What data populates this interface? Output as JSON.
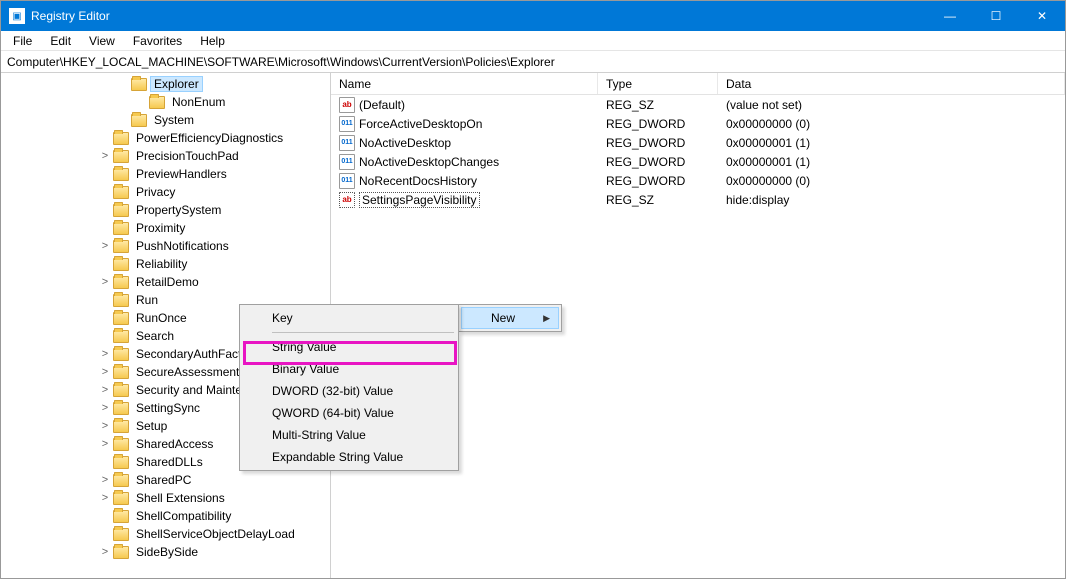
{
  "window": {
    "title": "Registry Editor"
  },
  "menu": {
    "items": [
      "File",
      "Edit",
      "View",
      "Favorites",
      "Help"
    ]
  },
  "address": {
    "path": "Computer\\HKEY_LOCAL_MACHINE\\SOFTWARE\\Microsoft\\Windows\\CurrentVersion\\Policies\\Explorer"
  },
  "tree": {
    "items": [
      {
        "depth": 0,
        "exp": "",
        "label": "Explorer",
        "selected": true
      },
      {
        "depth": 1,
        "exp": "",
        "label": "NonEnum"
      },
      {
        "depth": 0,
        "exp": "",
        "label": "System"
      },
      {
        "depth": -1,
        "exp": "",
        "label": "PowerEfficiencyDiagnostics"
      },
      {
        "depth": -1,
        "exp": ">",
        "label": "PrecisionTouchPad"
      },
      {
        "depth": -1,
        "exp": "",
        "label": "PreviewHandlers"
      },
      {
        "depth": -1,
        "exp": "",
        "label": "Privacy"
      },
      {
        "depth": -1,
        "exp": "",
        "label": "PropertySystem"
      },
      {
        "depth": -1,
        "exp": "",
        "label": "Proximity"
      },
      {
        "depth": -1,
        "exp": ">",
        "label": "PushNotifications"
      },
      {
        "depth": -1,
        "exp": "",
        "label": "Reliability"
      },
      {
        "depth": -1,
        "exp": ">",
        "label": "RetailDemo"
      },
      {
        "depth": -1,
        "exp": "",
        "label": "Run"
      },
      {
        "depth": -1,
        "exp": "",
        "label": "RunOnce"
      },
      {
        "depth": -1,
        "exp": "",
        "label": "Search"
      },
      {
        "depth": -1,
        "exp": ">",
        "label": "SecondaryAuthFactor"
      },
      {
        "depth": -1,
        "exp": ">",
        "label": "SecureAssessment"
      },
      {
        "depth": -1,
        "exp": ">",
        "label": "Security and Maintenance"
      },
      {
        "depth": -1,
        "exp": ">",
        "label": "SettingSync"
      },
      {
        "depth": -1,
        "exp": ">",
        "label": "Setup"
      },
      {
        "depth": -1,
        "exp": ">",
        "label": "SharedAccess"
      },
      {
        "depth": -1,
        "exp": "",
        "label": "SharedDLLs"
      },
      {
        "depth": -1,
        "exp": ">",
        "label": "SharedPC"
      },
      {
        "depth": -1,
        "exp": ">",
        "label": "Shell Extensions"
      },
      {
        "depth": -1,
        "exp": "",
        "label": "ShellCompatibility"
      },
      {
        "depth": -1,
        "exp": "",
        "label": "ShellServiceObjectDelayLoad"
      },
      {
        "depth": -1,
        "exp": ">",
        "label": "SideBySide"
      }
    ]
  },
  "list": {
    "headers": {
      "name": "Name",
      "type": "Type",
      "data": "Data"
    },
    "rows": [
      {
        "icon": "sz",
        "name": "(Default)",
        "type": "REG_SZ",
        "data": "(value not set)"
      },
      {
        "icon": "dw",
        "name": "ForceActiveDesktopOn",
        "type": "REG_DWORD",
        "data": "0x00000000 (0)"
      },
      {
        "icon": "dw",
        "name": "NoActiveDesktop",
        "type": "REG_DWORD",
        "data": "0x00000001 (1)"
      },
      {
        "icon": "dw",
        "name": "NoActiveDesktopChanges",
        "type": "REG_DWORD",
        "data": "0x00000001 (1)"
      },
      {
        "icon": "dw",
        "name": "NoRecentDocsHistory",
        "type": "REG_DWORD",
        "data": "0x00000000 (0)"
      },
      {
        "icon": "sz",
        "name": "SettingsPageVisibility",
        "type": "REG_SZ",
        "data": "hide:display",
        "selected": true
      }
    ]
  },
  "context_submenu": {
    "label": "New"
  },
  "context_new": {
    "items": [
      "Key",
      "-",
      "String Value",
      "Binary Value",
      "DWORD (32-bit) Value",
      "QWORD (64-bit) Value",
      "Multi-String Value",
      "Expandable String Value"
    ]
  }
}
